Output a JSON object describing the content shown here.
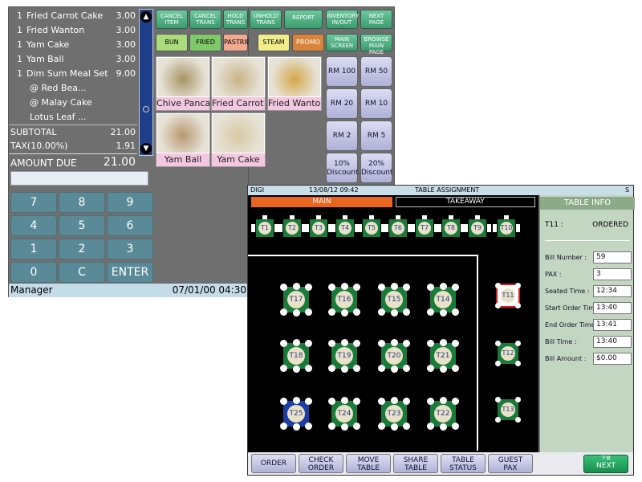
{
  "pos": {
    "order_items": [
      {
        "qty": "1",
        "name": "Fried Carrot Cake",
        "price": "3.00"
      },
      {
        "qty": "1",
        "name": "Fried Wanton",
        "price": "3.00"
      },
      {
        "qty": "1",
        "name": "Yam Cake",
        "price": "3.00"
      },
      {
        "qty": "1",
        "name": "Yam Ball",
        "price": "3.00"
      },
      {
        "qty": "1",
        "name": "Dim Sum Meal Set",
        "price": "9.00"
      },
      {
        "qty": "",
        "name": "@ Red Bea...",
        "price": ""
      },
      {
        "qty": "",
        "name": "@ Malay Cake",
        "price": ""
      },
      {
        "qty": "",
        "name": "Lotus Leaf ...",
        "price": ""
      }
    ],
    "subtotal_label": "SUBTOTAL",
    "subtotal_value": "21.00",
    "tax_label": "TAX(10.00%)",
    "tax_value": "1.91",
    "amount_due_label": "AMOUNT DUE",
    "amount_due_value": "21.00",
    "amount_input_value": "",
    "keypad": [
      "7",
      "8",
      "9",
      "4",
      "5",
      "6",
      "1",
      "2",
      "3",
      "0",
      "C",
      "ENTER"
    ],
    "status_user": "Manager",
    "status_datetime": "07/01/00 04:30",
    "function_buttons": [
      {
        "line1": "CANCEL",
        "line2": "ITEM"
      },
      {
        "line1": "CANCEL",
        "line2": "TRANS"
      },
      {
        "line1": "HOLD",
        "line2": "TRANS"
      },
      {
        "line1": "UNHOLD",
        "line2": "TRANS"
      },
      {
        "line1": "REPORT",
        "line2": ""
      },
      {
        "line1": "INVENTORY",
        "line2": "IN/OUT"
      },
      {
        "line1": "NEXT",
        "line2": "PAGE"
      }
    ],
    "categories": [
      {
        "label": "BUN",
        "color": "#a9dd7c"
      },
      {
        "label": "FRIED",
        "color": "#7fc96a"
      },
      {
        "label": "PASTRIES",
        "color": "#f3a98f"
      },
      {
        "label": "STEAM",
        "color": "#f1ee8a"
      },
      {
        "label": "PROMO",
        "color": "#d9843a"
      }
    ],
    "nav_buttons": [
      {
        "line1": "MAIN",
        "line2": "SCREEN"
      },
      {
        "line1": "BROWSE",
        "line2": "MAIN PAGE"
      }
    ],
    "products": [
      {
        "label": "Chive Pancake",
        "photo": "#a89464"
      },
      {
        "label": "Fried Carrot Cake",
        "photo": "#c9b387"
      },
      {
        "label": "Fried Wanton",
        "photo": "#d4a84a"
      },
      {
        "label": "Yam Ball",
        "photo": "#b89870"
      },
      {
        "label": "Yam Cake",
        "photo": "#d8c9a4"
      }
    ],
    "cash_buttons": [
      {
        "line1": "RM 100",
        "line2": ""
      },
      {
        "line1": "RM 50",
        "line2": ""
      },
      {
        "line1": "RM 20",
        "line2": ""
      },
      {
        "line1": "RM 10",
        "line2": ""
      },
      {
        "line1": "RM 2",
        "line2": ""
      },
      {
        "line1": "RM 5",
        "line2": ""
      },
      {
        "line1": "10%",
        "line2": "Discount"
      },
      {
        "line1": "20%",
        "line2": "Discount"
      }
    ]
  },
  "table_assignment": {
    "header_left": "DIGI",
    "header_datetime": "13/08/12 09:42",
    "header_title": "TABLE ASSIGNMENT",
    "header_right": "S",
    "tab_main": "MAIN",
    "tab_takeaway": "TAKEAWAY",
    "top_tables": [
      "T1",
      "T2",
      "T3",
      "T4",
      "T5",
      "T6",
      "T7",
      "T8",
      "T9",
      "T10"
    ],
    "floor_tables": [
      {
        "label": "T17",
        "color": "green"
      },
      {
        "label": "T16",
        "color": "green"
      },
      {
        "label": "T15",
        "color": "green"
      },
      {
        "label": "T14",
        "color": "green"
      },
      {
        "label": "T18",
        "color": "green"
      },
      {
        "label": "T19",
        "color": "green"
      },
      {
        "label": "T20",
        "color": "green"
      },
      {
        "label": "T21",
        "color": "green"
      },
      {
        "label": "T25",
        "color": "blue"
      },
      {
        "label": "T24",
        "color": "green"
      },
      {
        "label": "T23",
        "color": "green"
      },
      {
        "label": "T22",
        "color": "green"
      }
    ],
    "side_tables": [
      {
        "label": "T11",
        "selected": true
      },
      {
        "label": "T12",
        "selected": false
      },
      {
        "label": "T13",
        "selected": false
      }
    ],
    "info": {
      "title": "TABLE INFO",
      "table": "T11 :",
      "status": "ORDERED",
      "fields": [
        {
          "label": "Bill Number :",
          "value": "59"
        },
        {
          "label": "PAX :",
          "value": "3"
        },
        {
          "label": "Seated Time :",
          "value": "12:34"
        },
        {
          "label": "Start Order Time :",
          "value": "13:40"
        },
        {
          "label": "End Order Time :",
          "value": "13:41"
        },
        {
          "label": "Bill Time :",
          "value": "13:40"
        },
        {
          "label": "Bill Amount :",
          "value": "$0.00"
        }
      ]
    },
    "bottom_buttons": [
      {
        "line1": "ORDER",
        "line2": ""
      },
      {
        "line1": "CHECK",
        "line2": "ORDER"
      },
      {
        "line1": "MOVE",
        "line2": "TABLE"
      },
      {
        "line1": "SHARE",
        "line2": "TABLE"
      },
      {
        "line1": "TABLE",
        "line2": "STATUS"
      },
      {
        "line1": "GUEST",
        "line2": "PAX"
      }
    ],
    "next_small": "下頁",
    "next_label": "NEXT"
  }
}
